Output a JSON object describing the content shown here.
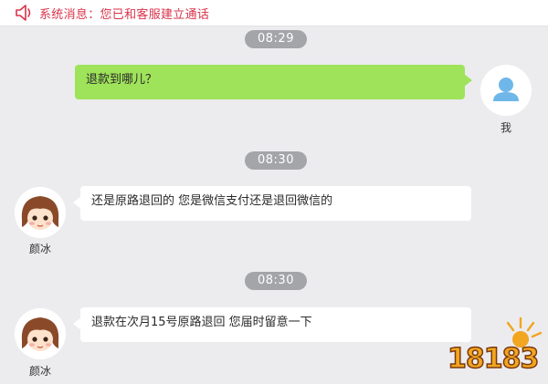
{
  "system": {
    "icon": "speaker-icon",
    "message": "系统消息：您已和客服建立通话",
    "color": "#d9334a"
  },
  "conversation": [
    {
      "time": "08:29",
      "sender": "me",
      "name": "我",
      "text": "退款到哪儿？",
      "avatar_icon": "user-icon"
    },
    {
      "time": "08:30",
      "sender": "agent",
      "name": "颜冰",
      "text": "还是原路退回的 您是微信支付还是退回微信的",
      "avatar_icon": "agent-avatar-icon"
    },
    {
      "time": "08:30",
      "sender": "agent",
      "name": "颜冰",
      "text": "退款在次月15号原路退回 您届时留意一下",
      "avatar_icon": "agent-avatar-icon"
    }
  ],
  "watermark": {
    "text": "18183",
    "icon": "watermark-logo-icon"
  },
  "colors": {
    "background": "#ececef",
    "my_bubble": "#9ee35a",
    "agent_bubble": "#ffffff",
    "time_pill": "#a3a5a8",
    "user_avatar": "#6fb7e9"
  }
}
